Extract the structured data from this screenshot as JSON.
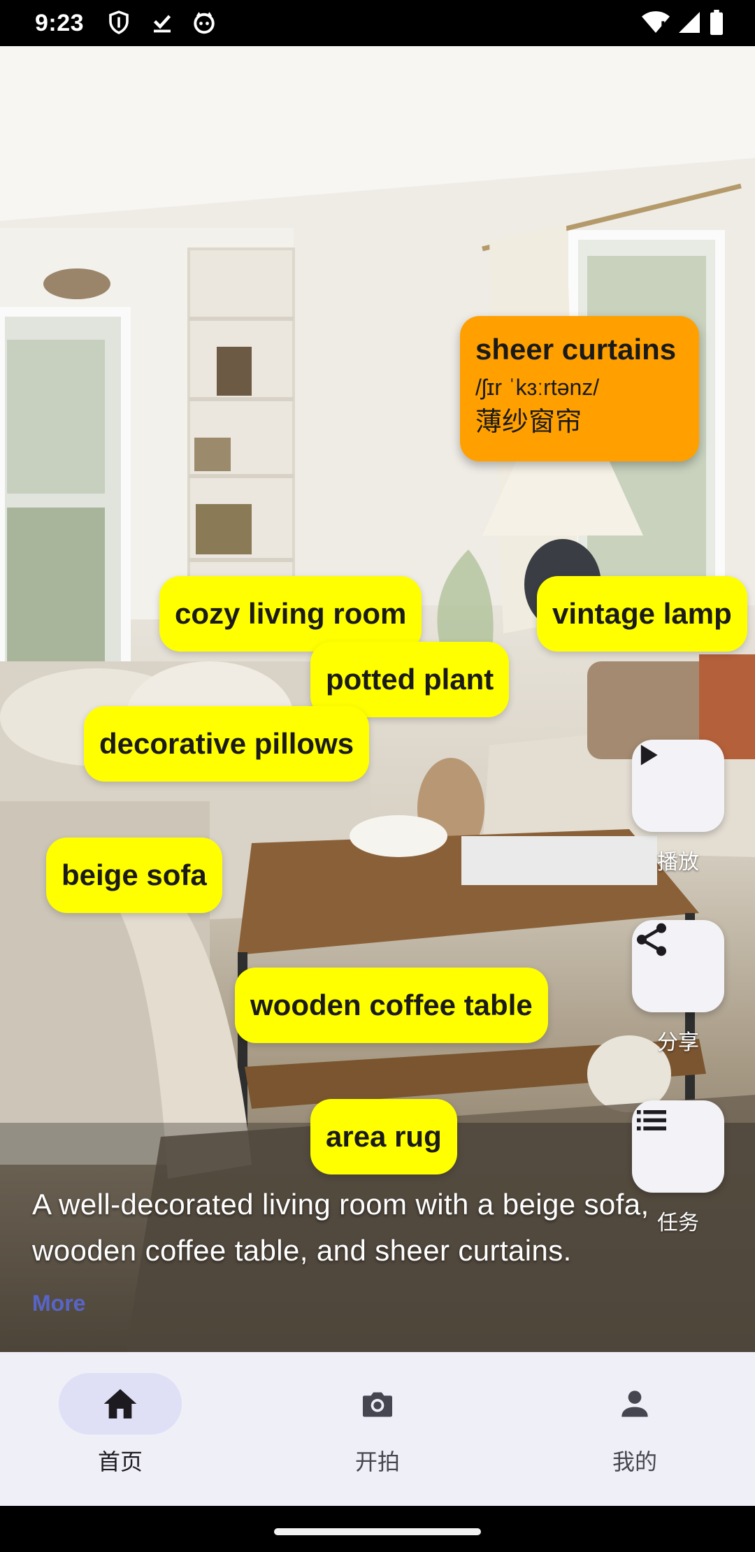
{
  "status_bar": {
    "time": "9:23",
    "left_icons": [
      "shield-icon",
      "download-done-icon",
      "cat-face-icon"
    ],
    "right_icons": [
      "wifi-icon",
      "signal-icon",
      "battery-icon"
    ]
  },
  "card": {
    "word": "sheer curtains",
    "phonetic": "/ʃɪr ˈkɜːrtənz/",
    "translation": "薄纱窗帘",
    "color": "#ffa000"
  },
  "tags": [
    "cozy living room",
    "vintage lamp",
    "potted plant",
    "decorative pillows",
    "beige sofa",
    "wooden coffee table",
    "area rug"
  ],
  "tag_color": "#ffff00",
  "actions": {
    "play": "播放",
    "share": "分享",
    "tasks": "任务"
  },
  "caption": "A well-decorated living room with a beige sofa, wooden coffee table, and sheer curtains.",
  "more_label": "More",
  "bottom_nav": {
    "home": "首页",
    "camera": "开拍",
    "mine": "我的",
    "active": "home"
  }
}
